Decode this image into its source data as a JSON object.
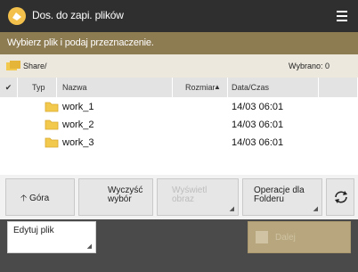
{
  "window": {
    "title": "Dos. do zapi. plików"
  },
  "instruction": "Wybierz plik i podaj przeznaczenie.",
  "path": {
    "text": "Share/",
    "selected_count": "Wybrano: 0"
  },
  "table": {
    "headers": {
      "type": "Typ",
      "name": "Nazwa",
      "size": "Rozmiar",
      "date": "Data/Czas"
    },
    "rows": [
      {
        "name": "work_1",
        "date": "14/03  06:01"
      },
      {
        "name": "work_2",
        "date": "14/03  06:01"
      },
      {
        "name": "work_3",
        "date": "14/03  06:01"
      }
    ]
  },
  "toolbar": {
    "up_label": "Góra",
    "clear_label": "Wyczyść wybór",
    "show_label": "Wyświetl obraz",
    "folder_ops_label": "Operacje dla Folderu"
  },
  "bottom": {
    "edit_label": "Edytuj plik",
    "ok_label": "Dalej"
  },
  "colors": {
    "titlebar": "#2f2f2f",
    "instruction_bar": "#8d7b52",
    "folder": "#f2c94c"
  }
}
